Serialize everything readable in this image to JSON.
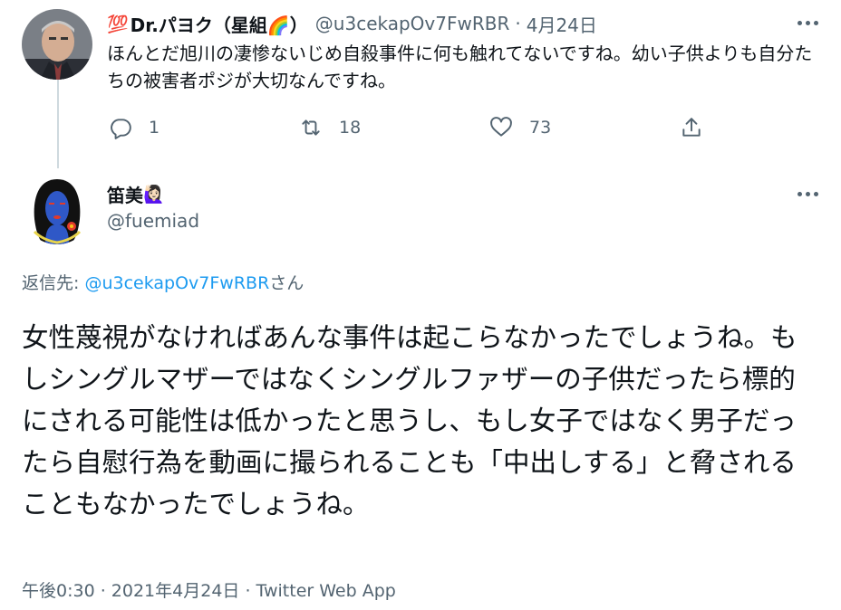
{
  "parent_tweet": {
    "emoji": "💯",
    "name": "Dr.パヨク（星組🌈）",
    "handle": "@u3cekapOv7FwRBR",
    "separator": "·",
    "date": "4月24日",
    "text": "ほんとだ旭川の凄惨ないじめ自殺事件に何も触れてないですね。幼い子供よりも自分たちの被害者ポジが大切なんですね。",
    "actions": {
      "reply_count": "1",
      "retweet_count": "18",
      "like_count": "73"
    }
  },
  "main_tweet": {
    "name": "笛美",
    "name_emoji": "🙋🏻‍♀️",
    "handle": "@fuemiad",
    "replying_prefix": "返信先: ",
    "replying_to": "@u3cekapOv7FwRBR",
    "replying_suffix": "さん",
    "text": "女性蔑視がなければあんな事件は起こらなかったでしょうね。もしシングルマザーではなくシングルファザーの子供だったら標的にされる可能性は低かったと思うし、もし女子ではなく男子だったら自慰行為を動画に撮られることも「中出しする」と脅されることもなかったでしょうね。",
    "footer": "午後0:30 · 2021年4月24日 · Twitter Web App"
  },
  "icons": {
    "more": "more-horizontal-icon",
    "reply": "reply-icon",
    "retweet": "retweet-icon",
    "like": "heart-icon",
    "share": "share-icon"
  },
  "colors": {
    "link": "#1d9bf0",
    "secondary_text": "#536471",
    "primary_text": "#0f1419",
    "thread_line": "#cfd9de"
  }
}
